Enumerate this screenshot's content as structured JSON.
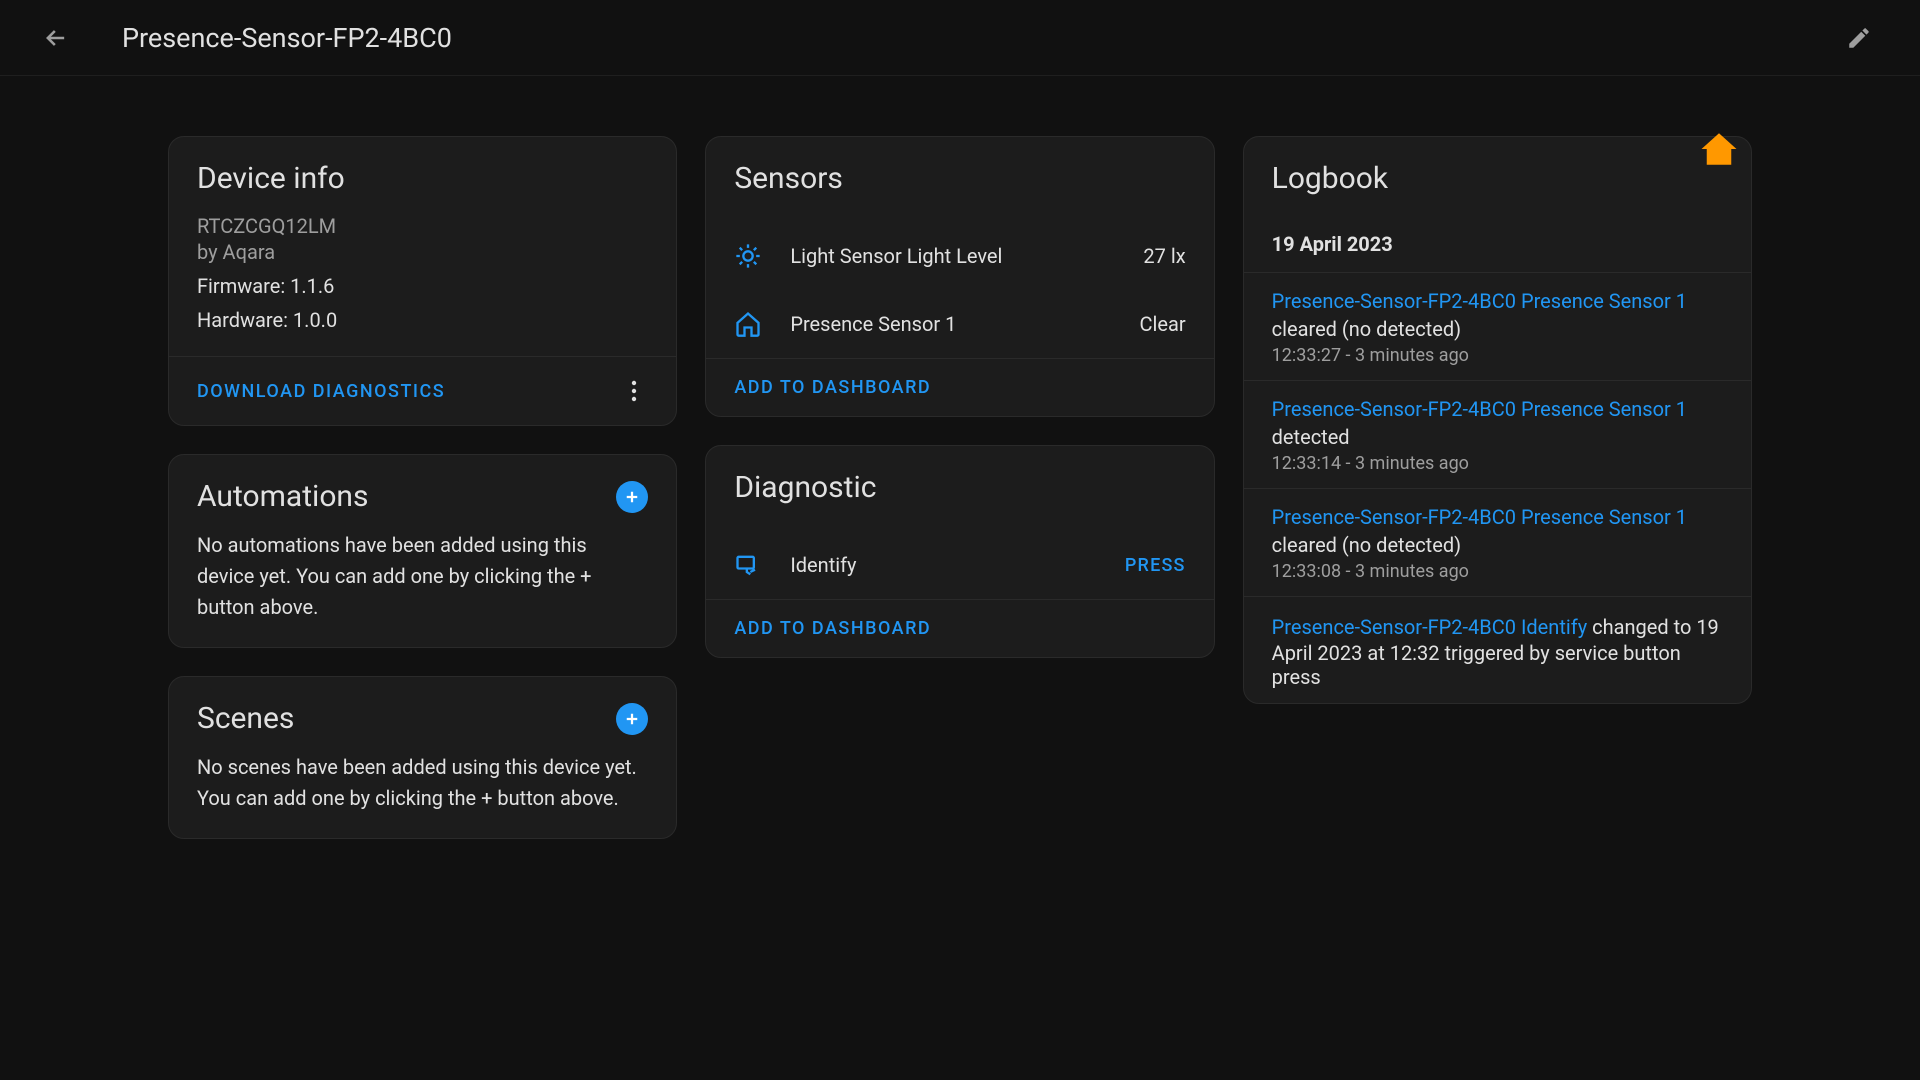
{
  "header": {
    "title": "Presence-Sensor-FP2-4BC0"
  },
  "device_info": {
    "title": "Device info",
    "model": "RTCZCGQ12LM",
    "manufacturer": "by Aqara",
    "firmware_label": "Firmware: 1.1.6",
    "hardware_label": "Hardware: 1.0.0",
    "download_btn": "DOWNLOAD DIAGNOSTICS"
  },
  "automations": {
    "title": "Automations",
    "empty": "No automations have been added using this device yet. You can add one by clicking the + button above."
  },
  "scenes": {
    "title": "Scenes",
    "empty": "No scenes have been added using this device yet. You can add one by clicking the + button above."
  },
  "sensors": {
    "title": "Sensors",
    "rows": [
      {
        "label": "Light Sensor Light Level",
        "value": "27 lx"
      },
      {
        "label": "Presence Sensor 1",
        "value": "Clear"
      }
    ],
    "add_btn": "ADD TO DASHBOARD"
  },
  "diagnostic": {
    "title": "Diagnostic",
    "identify_label": "Identify",
    "press_btn": "PRESS",
    "add_btn": "ADD TO DASHBOARD"
  },
  "logbook": {
    "title": "Logbook",
    "date": "19 April 2023",
    "entries": [
      {
        "link": "Presence-Sensor-FP2-4BC0 Presence Sensor 1",
        "event": "cleared (no detected)",
        "time": "12:33:27 - 3 minutes ago"
      },
      {
        "link": "Presence-Sensor-FP2-4BC0 Presence Sensor 1",
        "event": "detected",
        "time": "12:33:14 - 3 minutes ago"
      },
      {
        "link": "Presence-Sensor-FP2-4BC0 Presence Sensor 1",
        "event": "cleared (no detected)",
        "time": "12:33:08 - 3 minutes ago"
      },
      {
        "link": "Presence-Sensor-FP2-4BC0 Identify",
        "event_inline": " changed to 19 April 2023 at 12:32 triggered by service button press",
        "time": ""
      }
    ]
  }
}
